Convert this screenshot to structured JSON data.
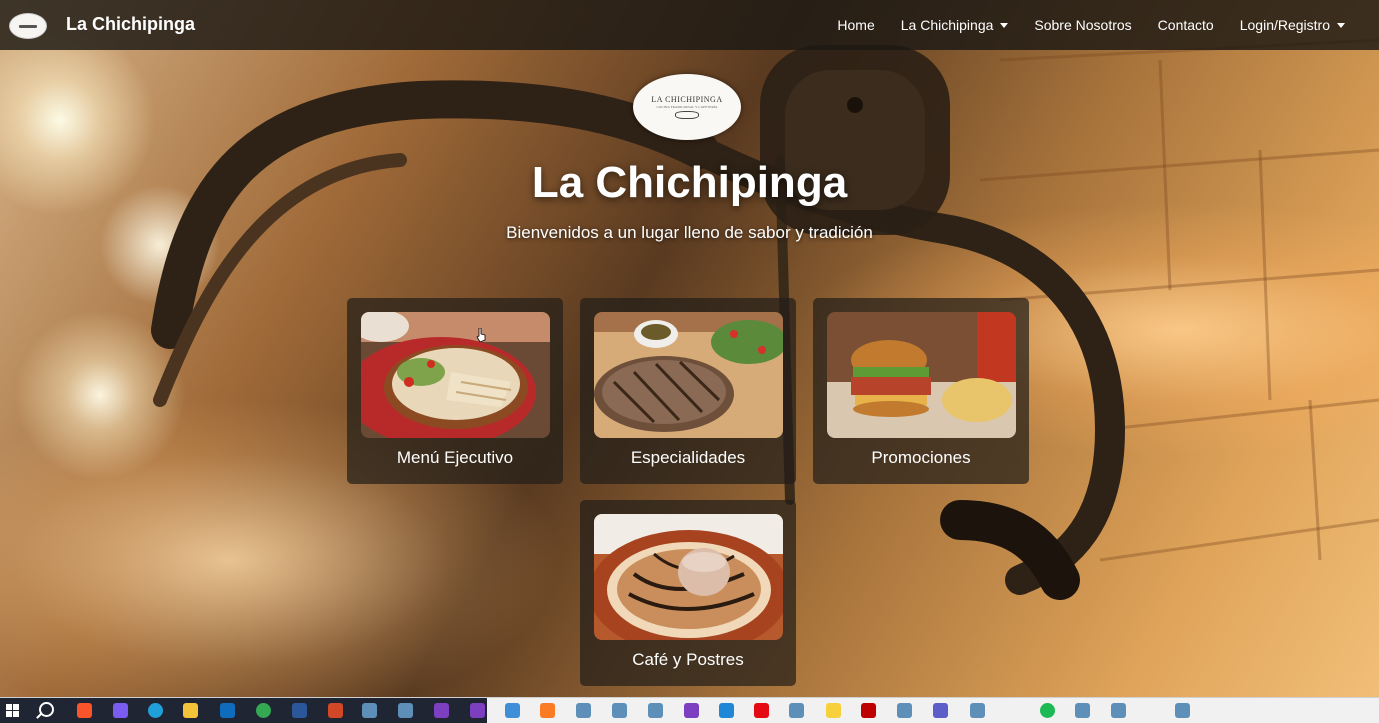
{
  "navbar": {
    "brand": "La Chichipinga",
    "links": [
      {
        "label": "Home",
        "dropdown": false
      },
      {
        "label": "La Chichipinga",
        "dropdown": true
      },
      {
        "label": "Sobre Nosotros",
        "dropdown": false
      },
      {
        "label": "Contacto",
        "dropdown": false
      },
      {
        "label": "Login/Registro",
        "dropdown": true
      }
    ]
  },
  "hero": {
    "logo_text": "LA CHICHIPINGA",
    "logo_subtext": "COCINA TRADICIONAL Y CAFETERÍA",
    "title": "La Chichipinga",
    "subtitle": "Bienvenidos a un lugar lleno de sabor y tradición"
  },
  "cards": [
    {
      "label": "Menú Ejecutivo",
      "photo": "salad-plate-photo"
    },
    {
      "label": "Especialidades",
      "photo": "steak-photo"
    },
    {
      "label": "Promociones",
      "photo": "burger-photo"
    },
    {
      "label": "Café y Postres",
      "photo": "dessert-photo"
    }
  ],
  "taskbar": {
    "icons": [
      "start-icon",
      "search-icon",
      "brave-icon",
      "copilot-icon",
      "edge-icon",
      "file-explorer-icon",
      "outlook-icon",
      "chrome-icon",
      "word-icon",
      "powerpoint-icon",
      "app-icon",
      "app-icon",
      "visual-studio-icon",
      "visual-studio-icon",
      "remote-icon",
      "xampp-icon",
      "app-icon",
      "app-icon",
      "app-icon",
      "visual-studio-icon",
      "vscode-icon",
      "netflix-icon",
      "app-icon",
      "sticky-notes-icon",
      "filezilla-icon",
      "app-icon",
      "teams-icon",
      "app-icon",
      "spotify-icon",
      "app-icon",
      "app-icon",
      "app-icon"
    ]
  },
  "colors": {
    "navbar_bg": "#1c1814",
    "card_bg": "#231e19",
    "text": "#ffffff"
  }
}
